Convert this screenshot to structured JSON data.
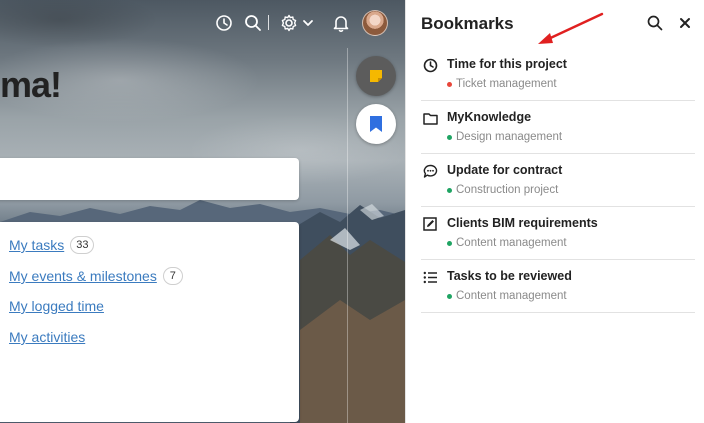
{
  "welcome": {
    "text_fragment": "ma!"
  },
  "toolbar": {
    "icons": [
      "timer-icon",
      "search-icon",
      "settings-icon",
      "bell-icon",
      "avatar"
    ]
  },
  "links": [
    {
      "label": "My tasks",
      "count": "33"
    },
    {
      "label": "My events & milestones",
      "count": "7"
    },
    {
      "label": "My logged time",
      "count": null
    },
    {
      "label": "My activities",
      "count": null
    }
  ],
  "fabs": {
    "notes": {
      "icon": "sticky-note-icon",
      "color": "#f5b800"
    },
    "bookmarks": {
      "icon": "bookmark-icon",
      "color": "#2f6fe0"
    }
  },
  "panel": {
    "title": "Bookmarks",
    "items": [
      {
        "icon": "clock-icon",
        "title": "Time for this project",
        "subtitle": "Ticket management",
        "dot_color": "#e8463a"
      },
      {
        "icon": "folder-icon",
        "title": "MyKnowledge",
        "subtitle": "Design management",
        "dot_color": "#1fa463"
      },
      {
        "icon": "chat-bubble-icon",
        "title": "Update for contract",
        "subtitle": "Construction project",
        "dot_color": "#1fa463"
      },
      {
        "icon": "edit-box-icon",
        "title": "Clients BIM requirements",
        "subtitle": "Content management",
        "dot_color": "#1fa463"
      },
      {
        "icon": "list-icon",
        "title": "Tasks to be reviewed",
        "subtitle": "Content management",
        "dot_color": "#1fa463"
      }
    ]
  },
  "colors": {
    "accent_arrow": "#e02020",
    "link": "#3b7bbf"
  }
}
